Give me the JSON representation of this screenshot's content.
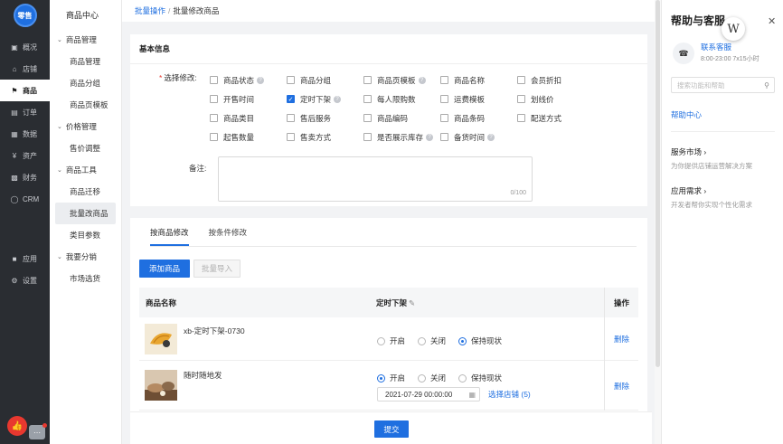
{
  "nav": {
    "logo": "零售",
    "items": [
      {
        "label": "概况",
        "icon": "monitor-icon"
      },
      {
        "label": "店铺",
        "icon": "shop-icon"
      },
      {
        "label": "商品",
        "icon": "tag-icon"
      },
      {
        "label": "订单",
        "icon": "order-icon"
      },
      {
        "label": "数据",
        "icon": "chart-icon"
      },
      {
        "label": "资产",
        "icon": "yen-icon"
      },
      {
        "label": "财务",
        "icon": "finance-icon"
      },
      {
        "label": "CRM",
        "icon": "user-icon"
      }
    ],
    "bottom": [
      {
        "label": "应用",
        "icon": "apps-icon"
      },
      {
        "label": "设置",
        "icon": "gear-icon"
      }
    ]
  },
  "subnav": {
    "header": "商品中心",
    "groups": [
      {
        "label": "商品管理",
        "items": [
          "商品管理",
          "商品分组",
          "商品页模板"
        ]
      },
      {
        "label": "价格管理",
        "items": [
          "售价调整"
        ]
      },
      {
        "label": "商品工具",
        "items": [
          "商品迁移",
          "批量改商品",
          "类目参数"
        ]
      },
      {
        "label": "我要分销",
        "items": [
          "市场选货"
        ]
      }
    ]
  },
  "breadcrumb": {
    "link": "批量操作",
    "sep": "/",
    "current": "批量修改商品"
  },
  "basic": {
    "title": "基本信息",
    "select_label": "选择修改:",
    "required_mark": "*",
    "options": [
      [
        {
          "label": "商品状态",
          "help": true,
          "checked": false
        },
        {
          "label": "商品分组",
          "help": false,
          "checked": false
        },
        {
          "label": "商品页模板",
          "help": true,
          "checked": false
        },
        {
          "label": "商品名称",
          "help": false,
          "checked": false
        },
        {
          "label": "会员折扣",
          "help": false,
          "checked": false
        }
      ],
      [
        {
          "label": "开售时间",
          "help": false,
          "checked": false
        },
        {
          "label": "定时下架",
          "help": true,
          "checked": true
        },
        {
          "label": "每人限购数",
          "help": false,
          "checked": false
        },
        {
          "label": "运费模板",
          "help": false,
          "checked": false
        },
        {
          "label": "划线价",
          "help": false,
          "checked": false
        }
      ],
      [
        {
          "label": "商品类目",
          "help": false,
          "checked": false
        },
        {
          "label": "售后服务",
          "help": false,
          "checked": false
        },
        {
          "label": "商品编码",
          "help": false,
          "checked": false
        },
        {
          "label": "商品条码",
          "help": false,
          "checked": false
        },
        {
          "label": "配送方式",
          "help": false,
          "checked": false
        }
      ],
      [
        {
          "label": "起售数量",
          "help": false,
          "checked": false
        },
        {
          "label": "售卖方式",
          "help": false,
          "checked": false
        },
        {
          "label": "是否展示库存",
          "help": true,
          "checked": false
        },
        {
          "label": "备货时间",
          "help": true,
          "checked": false
        }
      ]
    ],
    "remark_label": "备注:",
    "remark_count": "0/100"
  },
  "goods": {
    "tabs": [
      "按商品修改",
      "按条件修改"
    ],
    "add_button": "添加商品",
    "import_button": "批量导入",
    "columns": {
      "name": "商品名称",
      "field": "定时下架",
      "op": "操作"
    },
    "radio_labels": [
      "开启",
      "关闭",
      "保持现状"
    ],
    "rows": [
      {
        "name": "xb-定时下架-0730",
        "selected": 2,
        "thumb_color": "#e9a630",
        "op": "删除"
      },
      {
        "name": "随时随地发",
        "selected": 0,
        "thumb_color": "#8a6a4c",
        "date": "2021-07-29 00:00:00",
        "store_link": "选择店铺 (5)",
        "op": "删除"
      }
    ],
    "submit": "提交"
  },
  "help_panel": {
    "title": "帮助与客服",
    "badge": "W",
    "service_name": "联系客服",
    "service_time": "8:00-23:00  7x15小时",
    "search_placeholder": "搜索功能和帮助",
    "help_center": "帮助中心",
    "sections": [
      {
        "title": "服务市场",
        "desc": "为你提供店铺运营解决方案"
      },
      {
        "title": "应用需求",
        "desc": "开发者帮你实现个性化需求"
      }
    ]
  }
}
